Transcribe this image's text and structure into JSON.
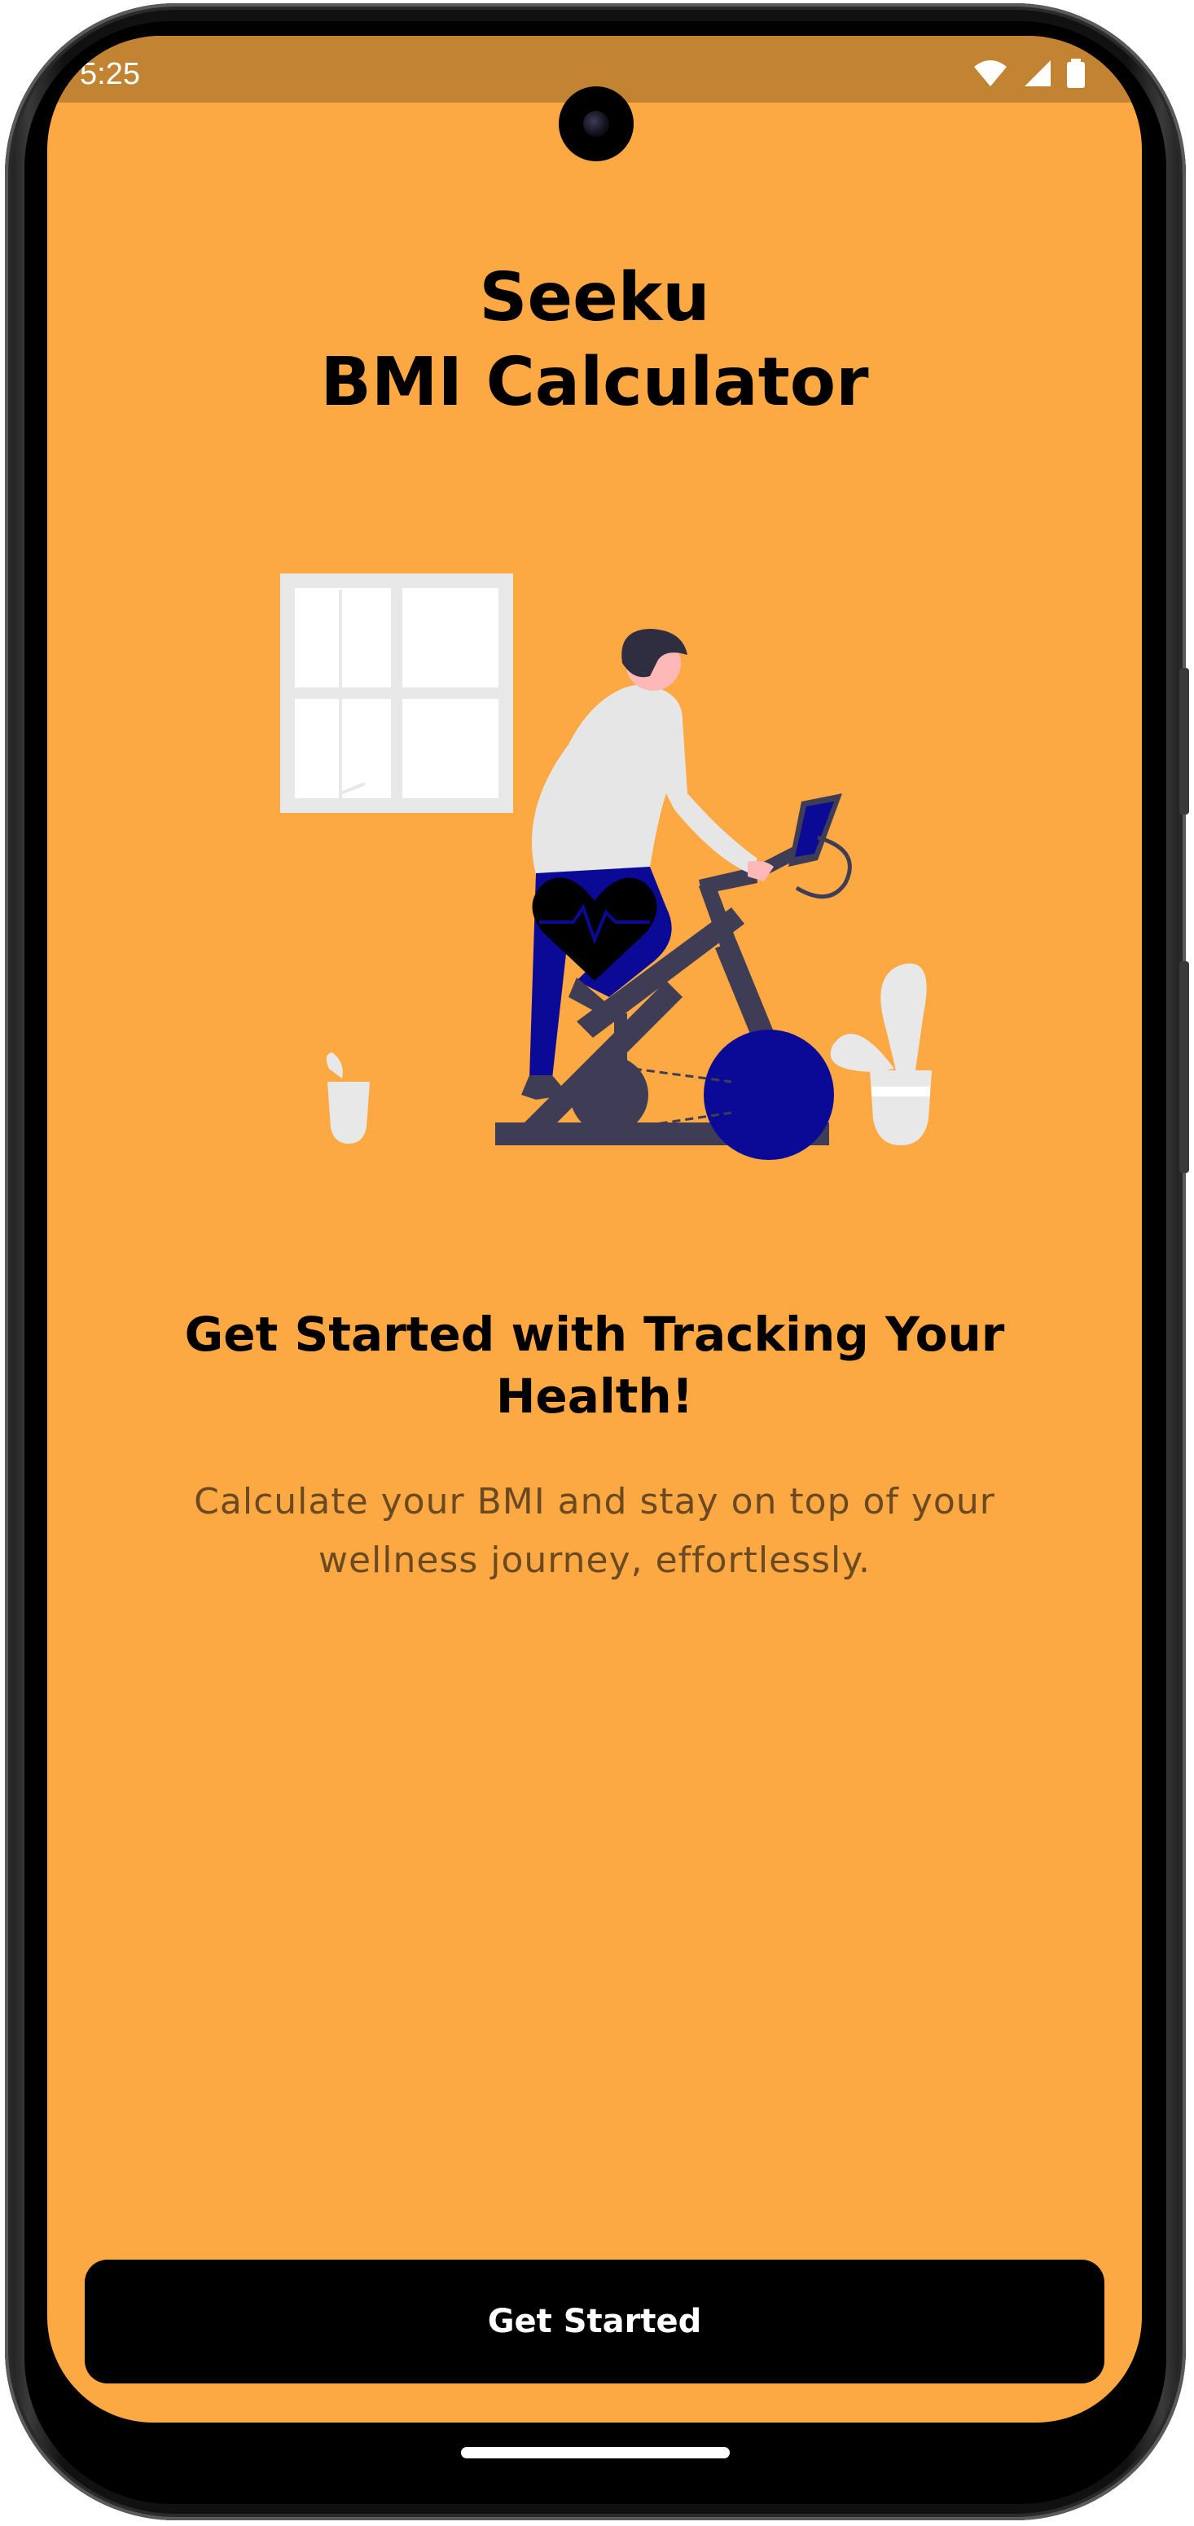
{
  "status_bar": {
    "time": "5:25",
    "icons": [
      "wifi-icon",
      "cellular-signal-icon",
      "battery-icon"
    ]
  },
  "app": {
    "title_line1": "Seeku",
    "title_line2": "BMI Calculator"
  },
  "illustration": {
    "name": "person-on-exercise-bike-illustration"
  },
  "onboarding": {
    "headline": "Get Started with Tracking Your Health!",
    "description": "Calculate your BMI and stay on top of your wellness journey, effortlessly."
  },
  "actions": {
    "get_started_label": "Get Started"
  },
  "colors": {
    "background": "#fca843",
    "status_bar": "#c28432",
    "button": "#000000",
    "button_text": "#ffffff",
    "accent_blue": "#0a0a96",
    "bike_gray": "#3f3d56"
  }
}
